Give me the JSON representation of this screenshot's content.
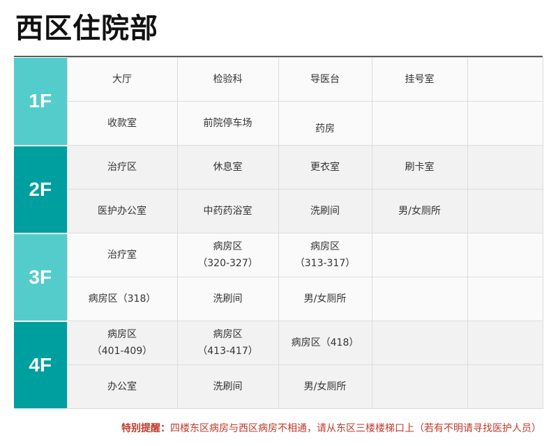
{
  "title": "西区住院部",
  "colors": {
    "floor_light": "#55cccc",
    "floor_dark": "#009f9f",
    "reminder": "#c0392b"
  },
  "floors": [
    {
      "label": "1F",
      "tone": "light",
      "rows": [
        [
          "大厅",
          "检验科",
          "导医台",
          "挂号室",
          ""
        ],
        [
          "收款室",
          "前院停车场",
          "药房",
          "",
          ""
        ]
      ]
    },
    {
      "label": "2F",
      "tone": "dark",
      "rows": [
        [
          "治疗区",
          "休息室",
          "更衣室",
          "刷卡室",
          ""
        ],
        [
          "医护办公室",
          "中药药浴室",
          "洗刷间",
          "男/女厕所",
          ""
        ]
      ]
    },
    {
      "label": "3F",
      "tone": "light",
      "rows": [
        [
          "治疗室",
          "病房区\n（320-327）",
          "病房区\n（313-317）",
          "",
          ""
        ],
        [
          "病房区（318）",
          "洗刷间",
          "男/女厕所",
          "",
          ""
        ]
      ]
    },
    {
      "label": "4F",
      "tone": "dark",
      "rows": [
        [
          "病房区\n（401-409）",
          "病房区\n（413-417）",
          "病房区（418）",
          "",
          ""
        ],
        [
          "办公室",
          "洗刷间",
          "男/女厕所",
          "",
          ""
        ]
      ]
    }
  ],
  "reminder": {
    "label": "特别提醒：",
    "text": "四楼东区病房与西区病房不相通，请从东区三楼楼梯口上（若有不明请寻找医护人员）"
  }
}
